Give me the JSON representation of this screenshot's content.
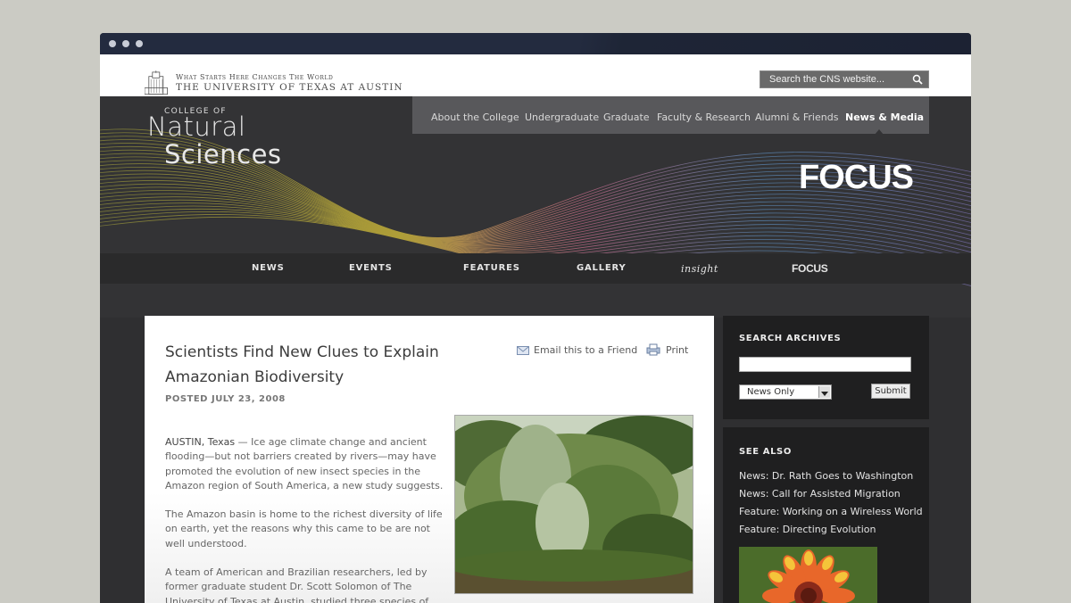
{
  "utd": {
    "tagline": "What Starts Here Changes The World",
    "university": "THE UNIVERSITY OF TEXAS AT AUSTIN",
    "search_placeholder": "Search the CNS website..."
  },
  "brand": {
    "college_of": "COLLEGE OF",
    "natural": "Natural",
    "sciences": "Sciences",
    "focus": "FOCUS"
  },
  "topnav": [
    {
      "label": "About the College"
    },
    {
      "label": "Undergraduate"
    },
    {
      "label": "Graduate"
    },
    {
      "label": "Faculty & Research"
    },
    {
      "label": "Alumni & Friends"
    },
    {
      "label": "News & Media"
    }
  ],
  "secnav": [
    {
      "label": "NEWS"
    },
    {
      "label": "EVENTS"
    },
    {
      "label": "FEATURES"
    },
    {
      "label": "GALLERY"
    },
    {
      "label": "insight"
    },
    {
      "label": "FOCUS"
    }
  ],
  "article": {
    "title": "Scientists Find New Clues to Explain Amazonian Biodiversity",
    "posted": "POSTED JULY 23, 2008",
    "email_label": "Email this to a Friend",
    "print_label": "Print",
    "dateline": "AUSTIN, Texas",
    "p1_rest": " — Ice age climate change and ancient flooding—but not barriers created by rivers—may have promoted the evolution of new insect species in the Amazon region of South America, a new study suggests.",
    "p2": "The Amazon basin is home to the richest diversity of life on earth, yet the reasons why this came to be are not well understood.",
    "p3": "A team of American and Brazilian researchers, led by former graduate student Dr. Scott Solomon of The University of Texas at Austin, studied three species of"
  },
  "sidebar": {
    "archives_heading": "SEARCH ARCHIVES",
    "archive_select": "News Only",
    "submit_label": "Submit",
    "see_also_heading": "SEE ALSO",
    "links": [
      {
        "label": "News: Dr. Rath Goes to Washington"
      },
      {
        "label": "News: Call for Assisted Migration"
      },
      {
        "label": "Feature: Working on a Wireless World"
      },
      {
        "label": "Feature: Directing Evolution"
      }
    ]
  },
  "colors": {
    "page_bg": "#cbcbc4",
    "titlebar": "#232b3f",
    "header_bg": "#333335",
    "sidebar_bg": "#1f1f20"
  }
}
